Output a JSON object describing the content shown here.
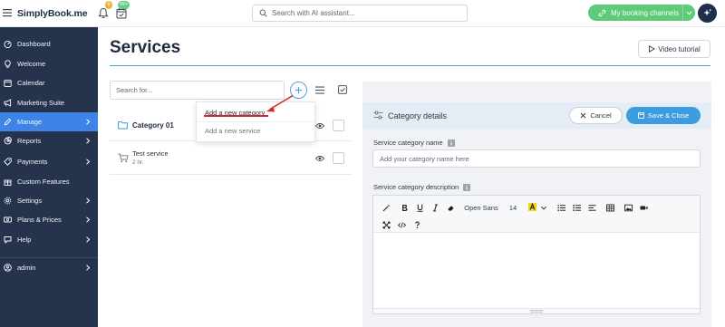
{
  "topbar": {
    "logo_text": "SimplyBook.me",
    "notifications_badge": "6",
    "calendar_badge": "99+",
    "search_placeholder": "Search with AI assistant...",
    "booking_channels_label": "My booking channels"
  },
  "sidebar": {
    "items": [
      {
        "label": "Dashboard",
        "icon": "dashboard-icon",
        "has_submenu": false,
        "active": false
      },
      {
        "label": "Welcome",
        "icon": "lightbulb-icon",
        "has_submenu": false,
        "active": false
      },
      {
        "label": "Calendar",
        "icon": "calendar-icon",
        "has_submenu": false,
        "active": false
      },
      {
        "label": "Marketing Suite",
        "icon": "megaphone-icon",
        "has_submenu": false,
        "active": false
      },
      {
        "label": "Manage",
        "icon": "pencil-icon",
        "has_submenu": true,
        "active": true
      },
      {
        "label": "Reports",
        "icon": "chart-icon",
        "has_submenu": true,
        "active": false
      },
      {
        "label": "Payments",
        "icon": "tag-icon",
        "has_submenu": true,
        "active": false
      },
      {
        "label": "Custom Features",
        "icon": "gift-icon",
        "has_submenu": false,
        "active": false
      },
      {
        "label": "Settings",
        "icon": "gear-icon",
        "has_submenu": true,
        "active": false
      },
      {
        "label": "Plans & Prices",
        "icon": "price-card-icon",
        "has_submenu": true,
        "active": false
      },
      {
        "label": "Help",
        "icon": "chat-icon",
        "has_submenu": true,
        "active": false
      }
    ],
    "user": {
      "label": "admin",
      "icon": "user-icon"
    }
  },
  "page": {
    "title": "Services",
    "video_tutorial_label": "Video tutorial"
  },
  "list": {
    "search_placeholder": "Search for...",
    "rows": [
      {
        "type": "category",
        "name": "Category 01"
      },
      {
        "type": "service",
        "name": "Test service",
        "duration": "2 hr."
      }
    ]
  },
  "add_menu": {
    "items": [
      "Add a new category",
      "Add a new service"
    ]
  },
  "detail": {
    "title": "Category details",
    "cancel_label": "Cancel",
    "save_label": "Save & Close",
    "name_label": "Service category name",
    "name_placeholder": "Add your category name here",
    "description_label": "Service category description",
    "editor": {
      "font_family": "Open Sans",
      "font_size": "14"
    }
  },
  "colors": {
    "sidebar_bg": "#26334d",
    "sidebar_active": "#3d84e6",
    "accent_green": "#5dcb77",
    "accent_blue": "#3d9be0",
    "annotation_red": "#e01f2b"
  }
}
